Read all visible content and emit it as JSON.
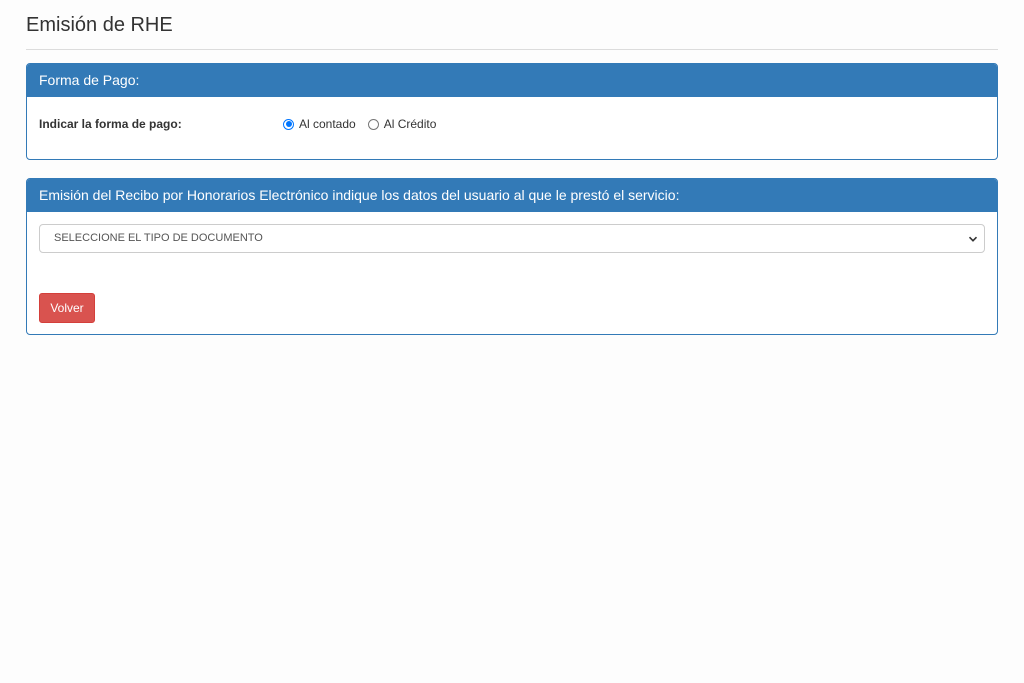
{
  "page": {
    "title": "Emisión de RHE"
  },
  "forma_pago": {
    "heading": "Forma de Pago:",
    "label": "Indicar la forma de pago:",
    "options": [
      {
        "label": "Al contado",
        "selected": true
      },
      {
        "label": "Al Crédito",
        "selected": false
      }
    ]
  },
  "emision": {
    "heading": "Emisión del Recibo por Honorarios Electrónico indique los datos del usuario al que le prestó el servicio:",
    "select_value": "SELECCIONE EL TIPO DE DOCUMENTO",
    "volver_label": "Volver"
  },
  "colors": {
    "panel_primary": "#337ab7",
    "danger": "#d9534f",
    "radio_accent": "#0075ff"
  },
  "icons": {
    "select_arrow": "chevron-down-icon"
  }
}
